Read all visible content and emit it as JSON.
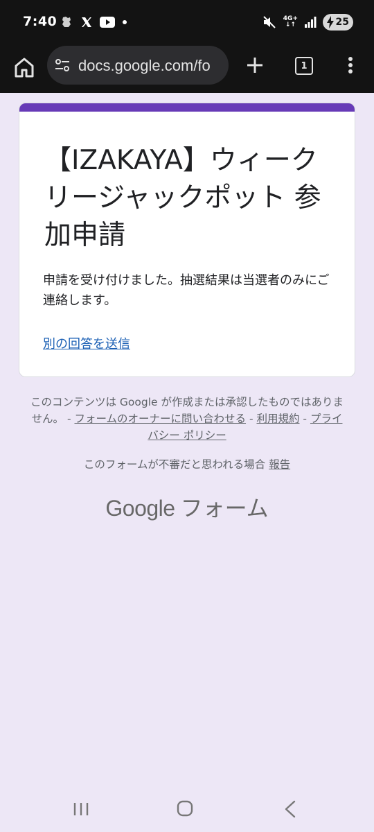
{
  "status_bar": {
    "time": "7:40",
    "network": "4G+",
    "battery": "25"
  },
  "browser": {
    "url": "docs.google.com/fo",
    "tab_count": "1"
  },
  "form": {
    "title": "【IZAKAYA】ウィークリージャックポット 参加申請",
    "confirmation_message": "申請を受け付けました。抽選結果は当選者のみにご連絡します。",
    "another_response_link": "別の回答を送信"
  },
  "footer": {
    "disclaimer_prefix": "このコンテンツは Google が作成または承認したものではありません。 - ",
    "contact_owner_link": "フォームのオーナーに問い合わせる",
    "separator_1": " - ",
    "terms_link": "利用規約",
    "separator_2": " - ",
    "privacy_link": "プライバシー ポリシー",
    "report_prefix": "このフォームが不審だと思われる場合 ",
    "report_link": "報告",
    "logo_brand": "Google",
    "logo_product": "フォーム"
  },
  "colors": {
    "accent": "#673ab7",
    "background": "#ede7f6",
    "link": "#1a5fb4"
  },
  "icons": [
    "home-icon",
    "site-settings-icon",
    "new-tab-plus-icon",
    "tab-switcher-icon",
    "more-vert-icon",
    "mute-icon",
    "signal-icon",
    "battery-icon",
    "recents-icon",
    "home-nav-icon",
    "back-icon"
  ]
}
